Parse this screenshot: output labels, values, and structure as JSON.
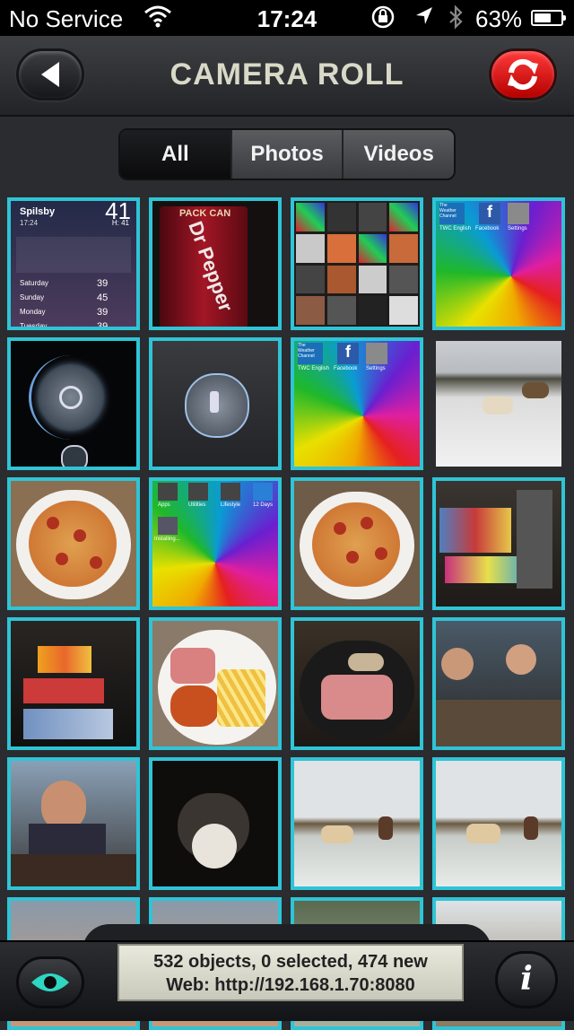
{
  "status_bar": {
    "carrier": "No Service",
    "time": "17:24",
    "battery": "63%",
    "battery_level": 0.63
  },
  "nav": {
    "title": "CAMERA ROLL",
    "back_icon": "back-arrow-icon",
    "refresh_icon": "refresh-icon"
  },
  "segments": [
    "All",
    "Photos",
    "Videos"
  ],
  "selected_segment": "All",
  "thumbnails": {
    "t1": {
      "location": "Spilsby",
      "time": "17:24",
      "temp": "41",
      "high": "H: 41",
      "days": [
        "Saturday",
        "Sunday",
        "Monday",
        "Tuesday"
      ],
      "day_temps": [
        "39",
        "45",
        "39",
        "39"
      ]
    },
    "t2": {
      "can_text": "PACK CAN",
      "brand": "Dr Pepper"
    },
    "t4": {
      "apps": [
        "TWC English",
        "Facebook",
        "Settings"
      ],
      "app_top": "The Weather Channel"
    },
    "t7": {
      "apps": [
        "TWC English",
        "Facebook",
        "Settings"
      ],
      "app_top": "The Weather Channel"
    },
    "t10": {
      "apps": [
        "Apps",
        "Utilities",
        "Lifestyle",
        "12 Days"
      ],
      "installing": "Installing..."
    }
  },
  "colors": {
    "accent_border": "#2fc4d6",
    "refresh_red": "#e60000",
    "eye_teal": "#2fd6c2"
  },
  "footer": {
    "line1": "532 objects, 0 selected, 474 new",
    "line2": "Web: http://192.168.1.70:8080",
    "eye_icon": "eye-icon",
    "info_label": "i"
  }
}
